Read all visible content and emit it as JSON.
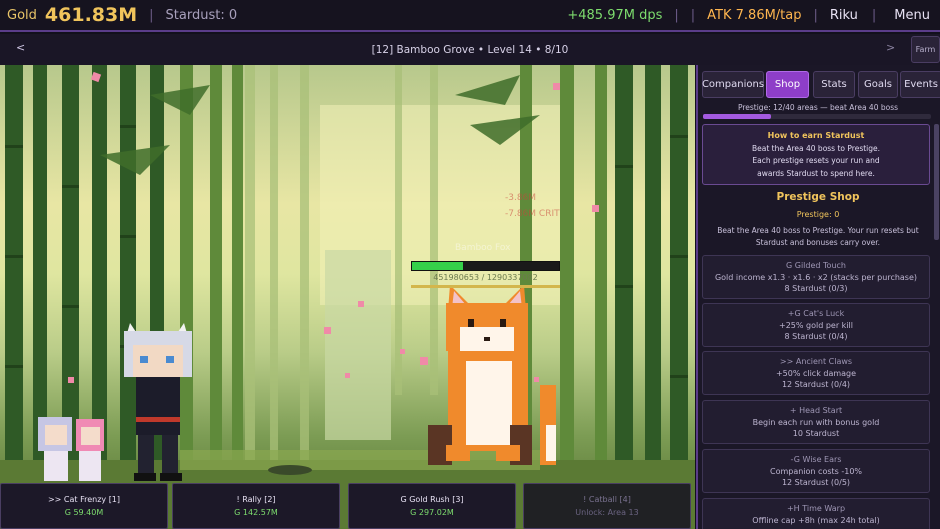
{
  "topbar": {
    "gold_label": "Gold",
    "gold_value": "461.83M",
    "stardust": "Stardust: 0",
    "dps": "+485.97M dps",
    "atk": "ATK 7.86M/tap",
    "user": "Riku",
    "menu": "Menu"
  },
  "area": {
    "prev": "<",
    "next": ">",
    "title": "[12] Bamboo Grove  •  Level 14  •  8/10",
    "farm": "Farm"
  },
  "enemy": {
    "hp_text": "451980653 / 1290337082",
    "hp_fraction": 0.35,
    "damage_popup_1": "-3.86M",
    "damage_popup_2": "-7.86M CRIT",
    "name_ghost": "Bamboo Fox"
  },
  "skills": [
    {
      "label": ">> Cat Frenzy [1]",
      "cost": "G 59.40M"
    },
    {
      "label": "! Rally [2]",
      "cost": "G 142.57M"
    },
    {
      "label": "G Gold Rush [3]",
      "cost": "G 297.02M"
    },
    {
      "label": "! Catball [4]",
      "cost": "Unlock: Area 13"
    }
  ],
  "panel": {
    "tabs": [
      "Companions",
      "Shop",
      "Stats",
      "Goals",
      "Events"
    ],
    "active_tab": "Shop",
    "progress_text": "Prestige: 12/40 areas — beat Area 40 boss",
    "progress_fraction": 0.3,
    "info": {
      "title": "How to earn Stardust",
      "line1": "Beat the Area 40 boss to Prestige.",
      "line2": "Each prestige resets your run and",
      "line3": "awards Stardust to spend here."
    },
    "shop_title": "Prestige Shop",
    "prestige_points": "Prestige: 0",
    "shop_desc": "Beat the Area 40 boss to Prestige. Your run resets but Stardust and bonuses carry over.",
    "upgrades": [
      {
        "name": "G Gilded Touch",
        "desc": "Gold income x1.3 · x1.6 · x2 (stacks per purchase)",
        "cost": "8 Stardust (0/3)"
      },
      {
        "name": "+G Cat's Luck",
        "desc": "+25% gold per kill",
        "cost": "8 Stardust (0/4)"
      },
      {
        "name": ">> Ancient Claws",
        "desc": "+50% click damage",
        "cost": "12 Stardust (0/4)"
      },
      {
        "name": "+ Head Start",
        "desc": "Begin each run with bonus gold",
        "cost": "10 Stardust"
      },
      {
        "name": "-G Wise Ears",
        "desc": "Companion costs -10%",
        "cost": "12 Stardust (0/5)"
      },
      {
        "name": "+H Time Warp",
        "desc": "Offline cap +8h (max 24h total)",
        "cost": ""
      }
    ]
  },
  "colors": {
    "accent": "#8e3ec8",
    "gold": "#f0c45c",
    "dps": "#7ddc6e",
    "atk": "#ffb64f",
    "hp": "#35d04a"
  }
}
